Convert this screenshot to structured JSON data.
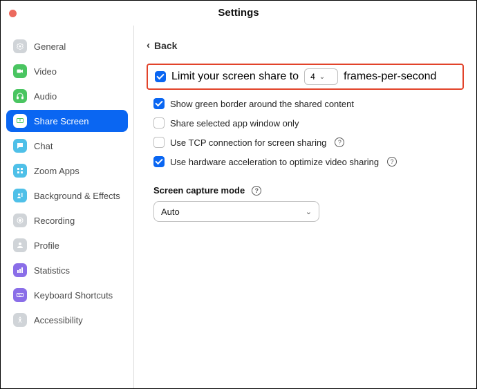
{
  "window": {
    "title": "Settings"
  },
  "back_label": "Back",
  "sidebar": {
    "items": [
      {
        "label": "General",
        "icon": "gear",
        "bg": "#d0d4d8",
        "fg": "#ffffff"
      },
      {
        "label": "Video",
        "icon": "camera",
        "bg": "#4ac561",
        "fg": "#ffffff"
      },
      {
        "label": "Audio",
        "icon": "headphones",
        "bg": "#4ac561",
        "fg": "#ffffff"
      },
      {
        "label": "Share Screen",
        "icon": "share",
        "bg": "#ffffff",
        "fg": "#4ac561",
        "active": true
      },
      {
        "label": "Chat",
        "icon": "chat",
        "bg": "#4fc0e8",
        "fg": "#ffffff"
      },
      {
        "label": "Zoom Apps",
        "icon": "apps",
        "bg": "#4fc0e8",
        "fg": "#ffffff"
      },
      {
        "label": "Background & Effects",
        "icon": "bg",
        "bg": "#4fc0e8",
        "fg": "#ffffff"
      },
      {
        "label": "Recording",
        "icon": "record",
        "bg": "#d0d4d8",
        "fg": "#ffffff"
      },
      {
        "label": "Profile",
        "icon": "profile",
        "bg": "#d0d4d8",
        "fg": "#ffffff"
      },
      {
        "label": "Statistics",
        "icon": "stats",
        "bg": "#8a6ee8",
        "fg": "#ffffff"
      },
      {
        "label": "Keyboard Shortcuts",
        "icon": "keyboard",
        "bg": "#8a6ee8",
        "fg": "#ffffff"
      },
      {
        "label": "Accessibility",
        "icon": "accessibility",
        "bg": "#d0d4d8",
        "fg": "#ffffff"
      }
    ]
  },
  "options": {
    "limit_fps": {
      "label_pre": "Limit your screen share to",
      "label_post": "frames-per-second",
      "value": "4",
      "checked": true,
      "highlighted": true
    },
    "green_border": {
      "label": "Show green border around the shared content",
      "checked": true
    },
    "app_window_only": {
      "label": "Share selected app window only",
      "checked": false
    },
    "tcp": {
      "label": "Use TCP connection for screen sharing",
      "checked": false,
      "help": true
    },
    "hw_accel": {
      "label": "Use hardware acceleration to optimize video sharing",
      "checked": true,
      "help": true
    }
  },
  "capture": {
    "section_label": "Screen capture mode",
    "help": true,
    "selected": "Auto"
  }
}
